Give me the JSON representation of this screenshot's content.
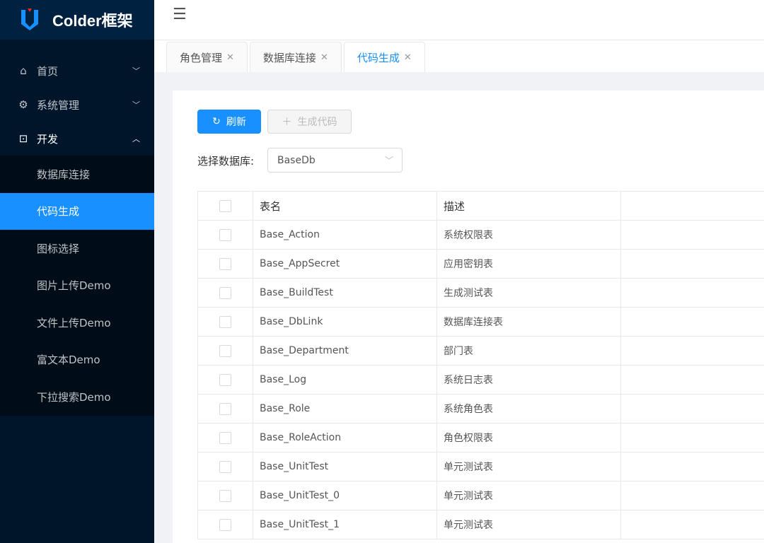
{
  "app": {
    "title": "Colder框架"
  },
  "sidebar": {
    "items": [
      {
        "label": "首页",
        "icon": "home-icon"
      },
      {
        "label": "系统管理",
        "icon": "gear-icon"
      },
      {
        "label": "开发",
        "icon": "terminal-icon"
      }
    ],
    "sub_items": [
      "数据库连接",
      "代码生成",
      "图标选择",
      "图片上传Demo",
      "文件上传Demo",
      "富文本Demo",
      "下拉搜索Demo"
    ]
  },
  "tabs": [
    "角色管理",
    "数据库连接",
    "代码生成"
  ],
  "toolbar": {
    "refresh": "刷新",
    "generate": "生成代码"
  },
  "filter": {
    "label": "选择数据库:",
    "value": "BaseDb"
  },
  "table": {
    "headers": [
      "表名",
      "描述"
    ],
    "rows": [
      [
        "Base_Action",
        "系统权限表"
      ],
      [
        "Base_AppSecret",
        "应用密钥表"
      ],
      [
        "Base_BuildTest",
        "生成测试表"
      ],
      [
        "Base_DbLink",
        "数据库连接表"
      ],
      [
        "Base_Department",
        "部门表"
      ],
      [
        "Base_Log",
        "系统日志表"
      ],
      [
        "Base_Role",
        "系统角色表"
      ],
      [
        "Base_RoleAction",
        "角色权限表"
      ],
      [
        "Base_UnitTest",
        "单元测试表"
      ],
      [
        "Base_UnitTest_0",
        "单元测试表"
      ],
      [
        "Base_UnitTest_1",
        "单元测试表"
      ]
    ]
  },
  "colors": {
    "primary": "#1890ff",
    "sidebar": "#001529"
  }
}
